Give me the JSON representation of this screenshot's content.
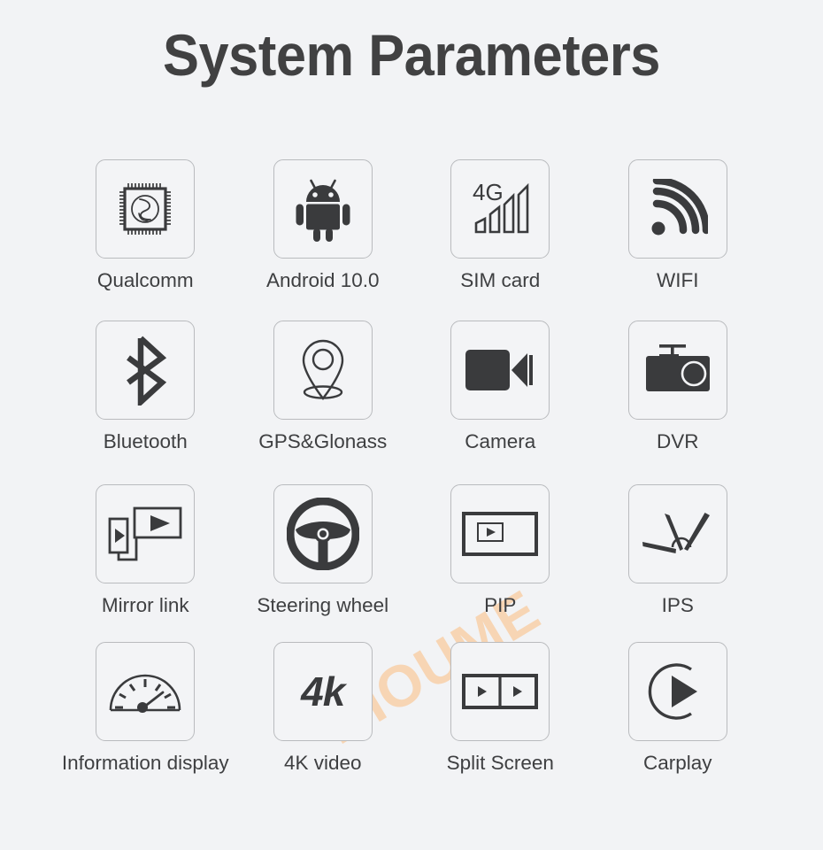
{
  "page": {
    "title": "System Parameters",
    "background_color": "#f2f3f5",
    "text_color": "#3e3f41",
    "icon_color": "#3a3b3d",
    "card_border_color": "#b9bbbe"
  },
  "watermark": {
    "text": "HIOUME",
    "color": "#f7d5b4"
  },
  "features": [
    {
      "label": "Qualcomm",
      "icon": "cpu-chip-icon"
    },
    {
      "label": "Android 10.0",
      "icon": "android-robot-icon"
    },
    {
      "label": "SIM card",
      "icon": "signal-bars-4g-icon",
      "icon_text": "4G"
    },
    {
      "label": "WIFI",
      "icon": "wifi-icon"
    },
    {
      "label": "Bluetooth",
      "icon": "bluetooth-icon"
    },
    {
      "label": "GPS&Glonass",
      "icon": "map-pin-icon"
    },
    {
      "label": "Camera",
      "icon": "video-camera-icon"
    },
    {
      "label": "DVR",
      "icon": "dashcam-icon"
    },
    {
      "label": "Mirror link",
      "icon": "screen-mirroring-icon"
    },
    {
      "label": "Steering wheel",
      "icon": "steering-wheel-icon"
    },
    {
      "label": "PIP",
      "icon": "picture-in-picture-icon"
    },
    {
      "label": "IPS",
      "icon": "viewing-angle-icon"
    },
    {
      "label": "Information display",
      "icon": "gauge-icon"
    },
    {
      "label": "4K video",
      "icon": "4k-text-icon",
      "icon_text": "4k"
    },
    {
      "label": "Split Screen",
      "icon": "split-screen-icon"
    },
    {
      "label": "Carplay",
      "icon": "carplay-play-circle-icon"
    }
  ]
}
